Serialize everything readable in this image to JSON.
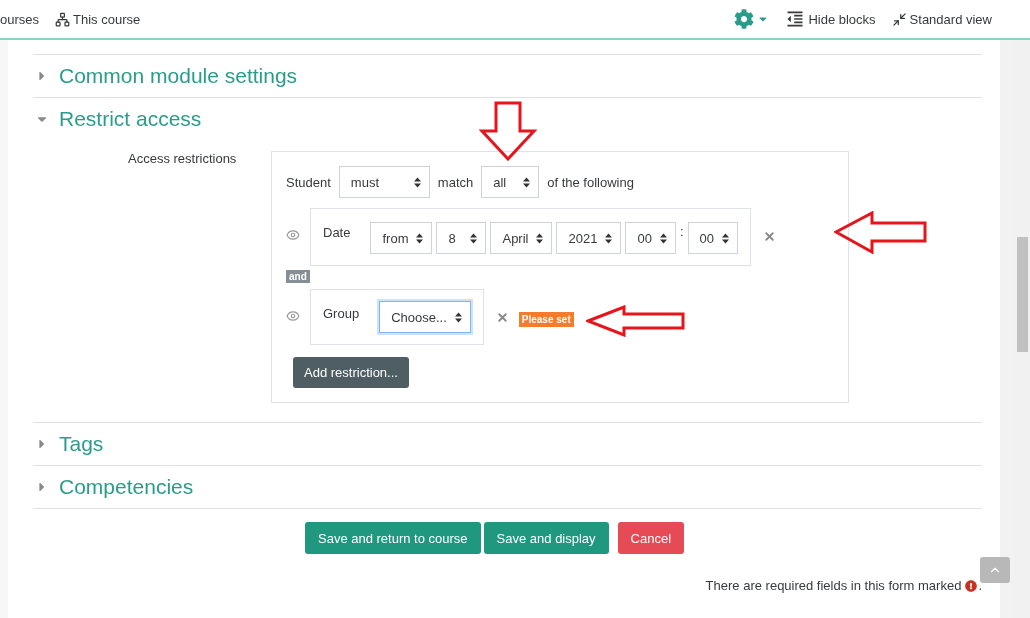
{
  "navbar": {
    "left_items": [
      {
        "label": "ourses",
        "kind": "text"
      },
      {
        "label": "This course",
        "kind": "sitemap"
      }
    ],
    "right_items": [
      {
        "kind": "gear"
      },
      {
        "kind": "hide",
        "label": "Hide blocks"
      },
      {
        "kind": "standard",
        "label": "Standard view"
      }
    ]
  },
  "sections_before": [
    {
      "title": "Common module settings",
      "expanded": false
    }
  ],
  "restrict": {
    "title": "Restrict access",
    "expanded": true,
    "label": "Access restrictions",
    "student_label": "Student",
    "must": "must",
    "match_label": "match",
    "match": "all",
    "suffix": "of the following",
    "conditions": [
      {
        "kind": "date",
        "label": "Date",
        "fields": [
          {
            "kind": "select",
            "value": "from"
          },
          {
            "kind": "select",
            "value": "8"
          },
          {
            "kind": "select",
            "value": "April"
          },
          {
            "kind": "select",
            "value": "2021"
          },
          {
            "kind": "select",
            "value": "00"
          },
          {
            "kind": "separator",
            "value": ":"
          },
          {
            "kind": "select",
            "value": "00"
          }
        ]
      },
      {
        "kind": "group",
        "label": "Group",
        "fields": [
          {
            "kind": "select",
            "value": "Choose...",
            "focused": true
          }
        ],
        "badge": "Please set"
      }
    ],
    "connector": "and",
    "add_button": "Add restriction..."
  },
  "sections_after": [
    {
      "title": "Tags",
      "expanded": false
    },
    {
      "title": "Competencies",
      "expanded": false
    }
  ],
  "buttons": [
    {
      "label": "Save and return to course",
      "kind": "primary"
    },
    {
      "label": "Save and display",
      "kind": "primary"
    },
    {
      "label": "Cancel",
      "kind": "danger"
    }
  ],
  "footer": "There are required fields in this form marked",
  "footer_end": "."
}
